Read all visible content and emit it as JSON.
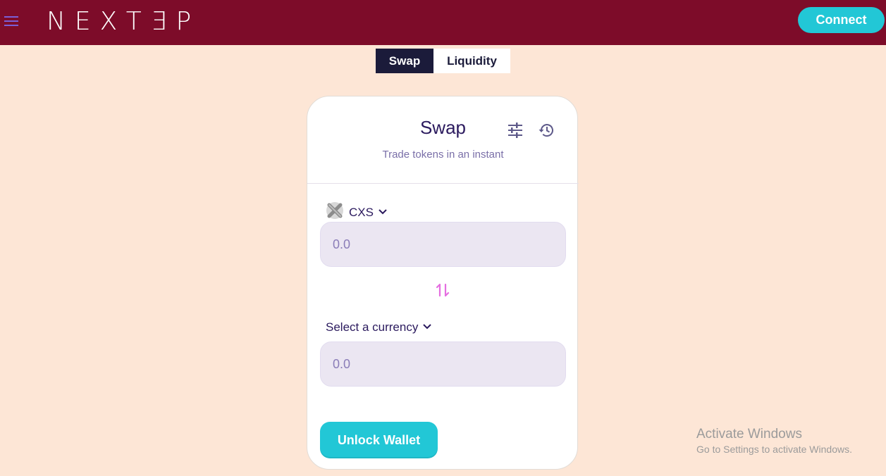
{
  "header": {
    "logo_text": "NEXTƎP",
    "connect_label": "Connect",
    "menu_icon": "hamburger-menu-icon"
  },
  "tabs": [
    {
      "label": "Swap",
      "active": true
    },
    {
      "label": "Liquidity",
      "active": false
    }
  ],
  "swap_card": {
    "title": "Swap",
    "subtitle": "Trade tokens in an instant",
    "settings_icon": "sliders-icon",
    "history_icon": "history-icon",
    "from": {
      "token_symbol": "CXS",
      "token_icon": "cxs-token-icon",
      "amount_placeholder": "0.0"
    },
    "switch_icon": "swap-arrows-icon",
    "to": {
      "token_label": "Select a currency",
      "amount_placeholder": "0.0"
    },
    "unlock_label": "Unlock Wallet"
  },
  "watermark": {
    "title": "Activate Windows",
    "subtitle": "Go to Settings to activate Windows."
  },
  "colors": {
    "header_bg": "#7d0c29",
    "page_bg": "#fde6d6",
    "accent": "#22c7d6",
    "tab_active_bg": "#1b1b3a",
    "title_text": "#2b1a5e",
    "switch_arrows": "#e56ee0"
  }
}
